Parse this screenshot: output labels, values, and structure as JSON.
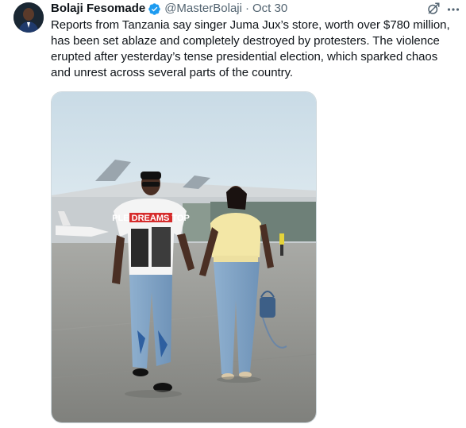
{
  "post": {
    "author": {
      "display_name": "Bolaji Fesomade",
      "handle": "@MasterBolaji",
      "verified_badge_icon": "verified-badge-icon"
    },
    "separator": "·",
    "date": "Oct 30",
    "text_lines": [
      "Reports from Tanzania say singer Juma Jux’s store, worth over $780 million,",
      "has been set ablaze and completely destroyed by protesters. The violence",
      "erupted after yesterday’s tense presidential election, which sparked chaos",
      "and unrest across several parts of the country."
    ],
    "media": {
      "shirt_print": "PLE DREAMS TOP"
    }
  },
  "icons": [
    "avatar",
    "verified-badge-icon",
    "grok-icon",
    "more-options-icon"
  ],
  "colors": {
    "text": "#0f1419",
    "secondary": "#536471",
    "verified": "#1d9bf0",
    "border": "#cfd9de"
  }
}
